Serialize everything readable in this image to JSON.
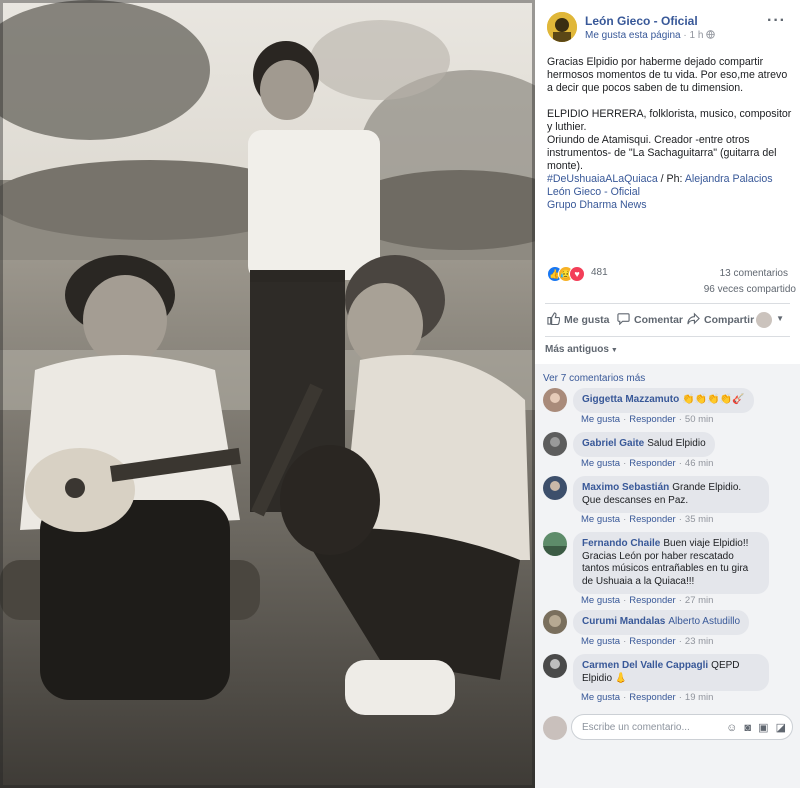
{
  "page": {
    "name": "León Gieco - Oficial",
    "like_page": "Me gusta esta página",
    "separator": " · ",
    "time": "1 h",
    "more_icon": "more-dots-icon"
  },
  "post": {
    "p1": "Gracias Elpidio por haberme dejado compartir hermosos momentos de tu vida. Por eso,me atrevo a decir que pocos saben de tu dimension.",
    "p2": "ELPIDIO HERRERA, folklorista, musico, compositor y luthier.",
    "p3": "Oriundo de Atamisqui. Creador -entre otros instrumentos- de \"La Sachaguitarra\" (guitarra del monte).",
    "hashtag": "#DeUshuaiaALaQuiaca",
    "ph_label": " / Ph: ",
    "photographer": "Alejandra Palacios",
    "tag1": "León Gieco - Oficial",
    "tag2": "Grupo Dharma News"
  },
  "stats": {
    "reactions": "481",
    "comments": "13 comentarios",
    "shares": "96 veces compartido"
  },
  "actions": {
    "like": "Me gusta",
    "comment": "Comentar",
    "share": "Compartir"
  },
  "older_label": "Más antiguos",
  "see_more": "Ver 7 comentarios más",
  "comment_actions": {
    "like": "Me gusta",
    "reply": "Responder",
    "dot": "·"
  },
  "comments": [
    {
      "author": "Giggetta Mazzamuto",
      "text": "👏👏👏👏🎸",
      "time": "50 min"
    },
    {
      "author": "Gabriel Gaite",
      "text": "Salud Elpidio",
      "time": "46 min"
    },
    {
      "author": "Maximo Sebastián",
      "text": "Grande Elpidio. Que descanses en Paz.",
      "time": "35 min"
    },
    {
      "author": "Fernando Chaile",
      "text": "Buen viaje Elpidio!! Gracias León por haber rescatado tantos músicos entrañables en tu gira de Ushuaia a la Quiaca!!!",
      "time": "27 min"
    },
    {
      "author": "Curumi Mandalas",
      "text": "Alberto Astudillo",
      "time": "23 min"
    },
    {
      "author": "Carmen Del Valle Cappagli",
      "text": "QEPD Elpidio 👃",
      "time": "19 min"
    }
  ],
  "compose": {
    "placeholder": "Escribe un comentario..."
  },
  "colors": {
    "link": "#385898",
    "like_blue": "#1877f2",
    "love_red": "#f33e58",
    "haha_yellow": "#f7b125"
  }
}
